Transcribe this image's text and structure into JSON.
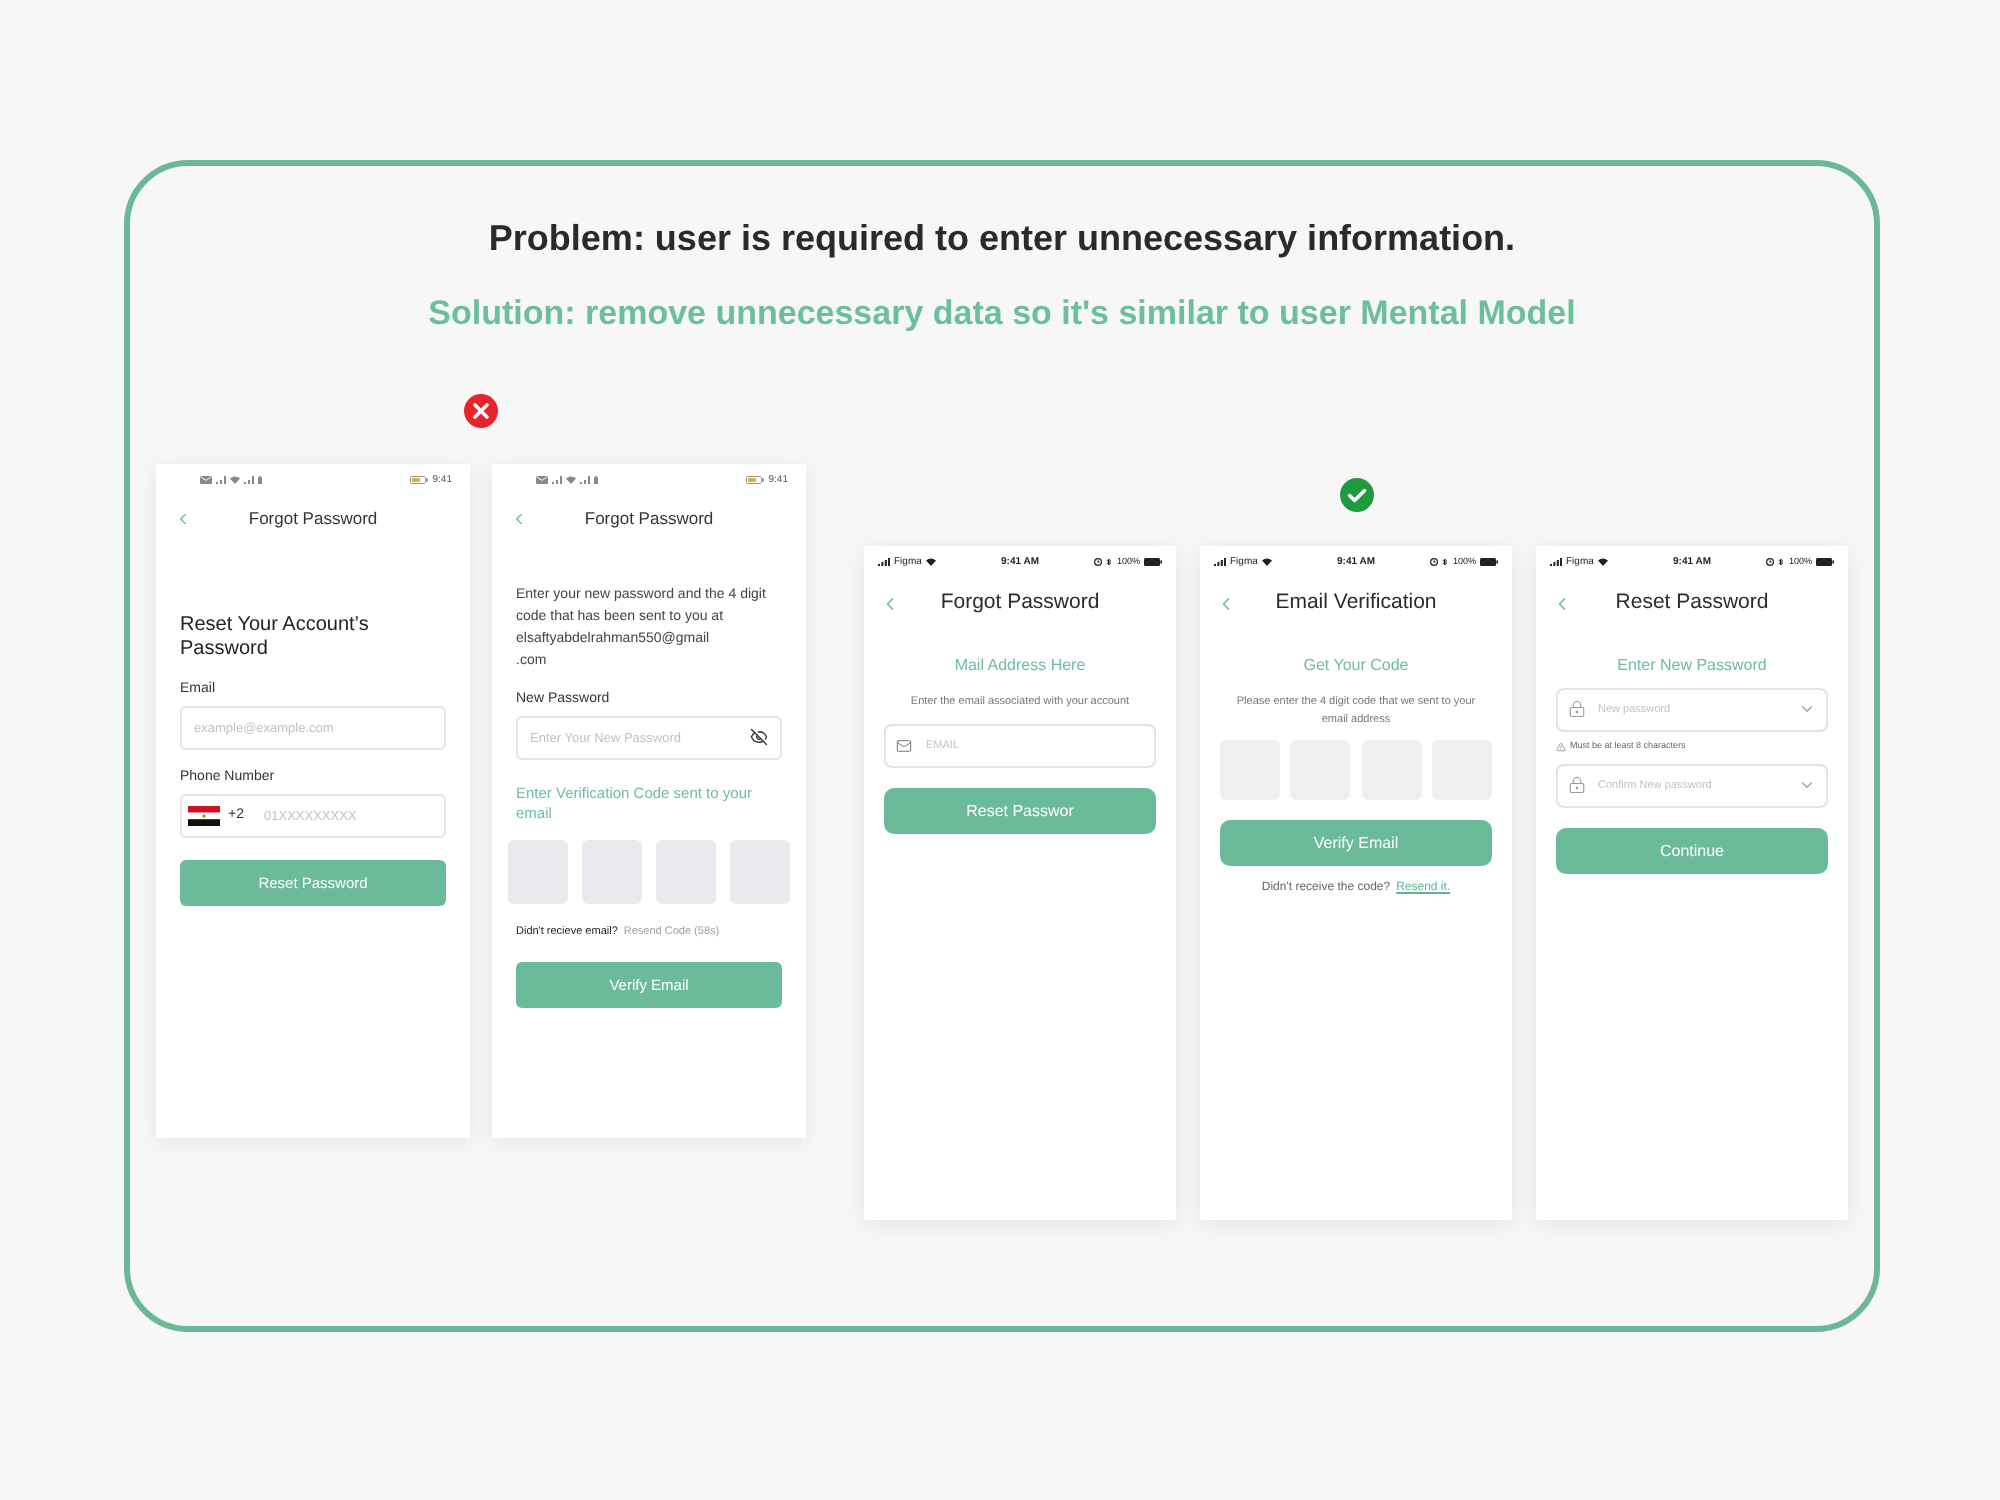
{
  "problem": "Problem: user is required to enter unnecessary information.",
  "solution": "Solution: remove unnecessary data so it's similar to user Mental Model",
  "groups": [
    {
      "kind": "rejected",
      "screens": [
        {
          "kind": "android",
          "status_bar": {
            "time": "9:41"
          },
          "title": "Forgot Password",
          "content": [
            {
              "kind": "heading",
              "text": "Reset Your Account’s Password"
            },
            {
              "kind": "label",
              "text": "Email"
            },
            {
              "kind": "input",
              "placeholder": "example@example.com"
            },
            {
              "kind": "label",
              "text": "Phone Number"
            },
            {
              "kind": "phone_input",
              "code": "+2",
              "placeholder": "01XXXXXXXXX"
            },
            {
              "kind": "button",
              "text": "Reset Password"
            }
          ]
        },
        {
          "kind": "android",
          "status_bar": {
            "time": "9:41"
          },
          "title": "Forgot Password",
          "content": [
            {
              "kind": "paragraph",
              "text": "Enter your new password and the 4 digit code that has been sent to you at elsaftyabdelrahman550@gmail\n.com"
            },
            {
              "kind": "label",
              "text": "New Password"
            },
            {
              "kind": "input",
              "placeholder": "Enter Your New Password",
              "trailing_icon": {
                "kind": "hide"
              }
            },
            {
              "kind": "prompt",
              "text": "Enter Verification Code sent to your email"
            },
            {
              "kind": "code_boxes"
            },
            {
              "kind": "resend",
              "question": "Didn't recieve email?",
              "action": {
                "kind": "timer",
                "text": "Resend Code (58s)"
              }
            },
            {
              "kind": "button",
              "text": "Verify Email"
            }
          ]
        }
      ]
    },
    {
      "kind": "approved",
      "screens": [
        {
          "kind": "ios",
          "status_bar": {
            "carrier": "Figma",
            "time": "9:41 AM",
            "battery": "100%"
          },
          "title": "Forgot Password",
          "content": [
            {
              "kind": "subtitle",
              "text": "Mail Address Here"
            },
            {
              "kind": "caption",
              "text": "Enter the email associated with your account"
            },
            {
              "kind": "input",
              "placeholder": "EMAIL",
              "leading_icon": {
                "kind": "mail"
              }
            },
            {
              "kind": "button",
              "text": "Reset Passwor"
            }
          ]
        },
        {
          "kind": "ios",
          "status_bar": {
            "carrier": "Figma",
            "time": "9:41 AM",
            "battery": "100%"
          },
          "title": "Email Verification",
          "content": [
            {
              "kind": "subtitle",
              "text": "Get Your Code"
            },
            {
              "kind": "caption",
              "text": "Please enter the 4 digit code that we sent to your email address"
            },
            {
              "kind": "code_boxes"
            },
            {
              "kind": "button",
              "text": "Verify Email"
            },
            {
              "kind": "resend",
              "question": "Didn't receive the code?",
              "action": {
                "kind": "link",
                "text": "Resend it."
              }
            }
          ]
        },
        {
          "kind": "ios",
          "status_bar": {
            "carrier": "Figma",
            "time": "9:41 AM",
            "battery": "100%"
          },
          "title": "Reset Password",
          "content": [
            {
              "kind": "subtitle",
              "text": "Enter New Password"
            },
            {
              "kind": "input",
              "placeholder": "New password",
              "leading_icon": {
                "kind": "lock"
              },
              "trailing_icon": {
                "kind": "chevron"
              }
            },
            {
              "kind": "hint",
              "text": "Must be at least 8 characters"
            },
            {
              "kind": "input",
              "placeholder": "Confirm New password",
              "leading_icon": {
                "kind": "lock"
              },
              "trailing_icon": {
                "kind": "chevron"
              }
            },
            {
              "kind": "button",
              "text": "Continue"
            }
          ]
        }
      ]
    }
  ]
}
